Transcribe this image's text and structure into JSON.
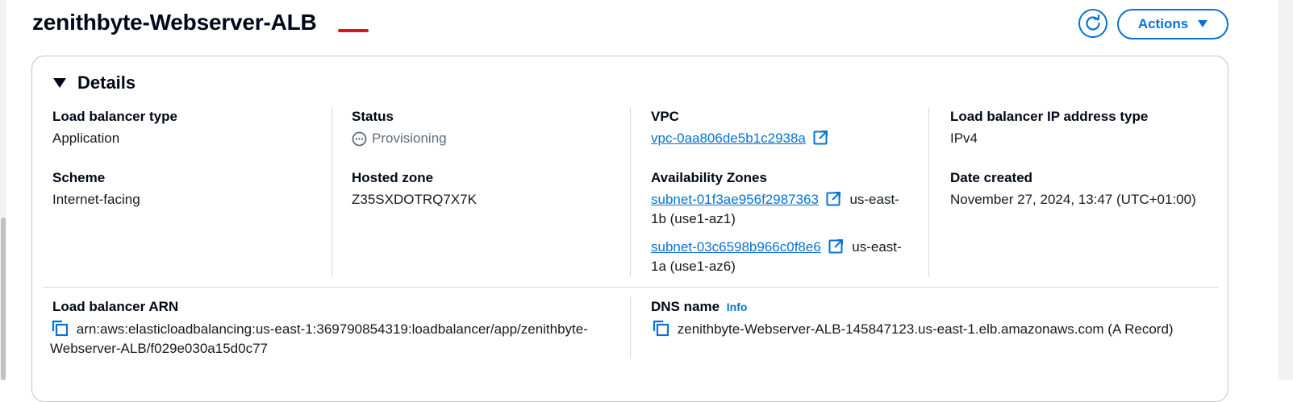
{
  "page": {
    "title": "zenithbyte-Webserver-ALB",
    "actions_label": "Actions",
    "refresh_icon": "refresh-icon",
    "actions_caret_icon": "caret-down-icon"
  },
  "details": {
    "heading": "Details",
    "lb_type_label": "Load balancer type",
    "lb_type_value": "Application",
    "scheme_label": "Scheme",
    "scheme_value": "Internet-facing",
    "status_label": "Status",
    "status_value": "Provisioning",
    "hosted_zone_label": "Hosted zone",
    "hosted_zone_value": "Z35SXDOTRQ7X7K",
    "vpc_label": "VPC",
    "vpc_value": "vpc-0aa806de5b1c2938a",
    "az_label": "Availability Zones",
    "subnets": [
      {
        "id": "subnet-01f3ae956f2987363",
        "zone_line1": "us-east-",
        "zone_line2": "1b (use1-az1)"
      },
      {
        "id": "subnet-03c6598b966c0f8e6",
        "zone_line1": "us-east-",
        "zone_line2": "1a (use1-az6)"
      }
    ],
    "ip_type_label": "Load balancer IP address type",
    "ip_type_value": "IPv4",
    "date_label": "Date created",
    "date_value": "November 27, 2024, 13:47 (UTC+01:00)",
    "arn_label": "Load balancer ARN",
    "arn_line1": "arn:aws:elasticloadbalancing:us-east-1:369790854319:loadbalancer/app/zenithbyte-",
    "arn_line2": "Webserver-ALB/f029e030a15d0c77",
    "dns_label": "DNS name",
    "dns_info": "Info",
    "dns_value": "zenithbyte-Webserver-ALB-145847123.us-east-1.elb.amazonaws.com (A Record)"
  },
  "colors": {
    "link": "#0972d3",
    "annotation_red": "#d91515",
    "status_gray": "#5f6b7a"
  }
}
